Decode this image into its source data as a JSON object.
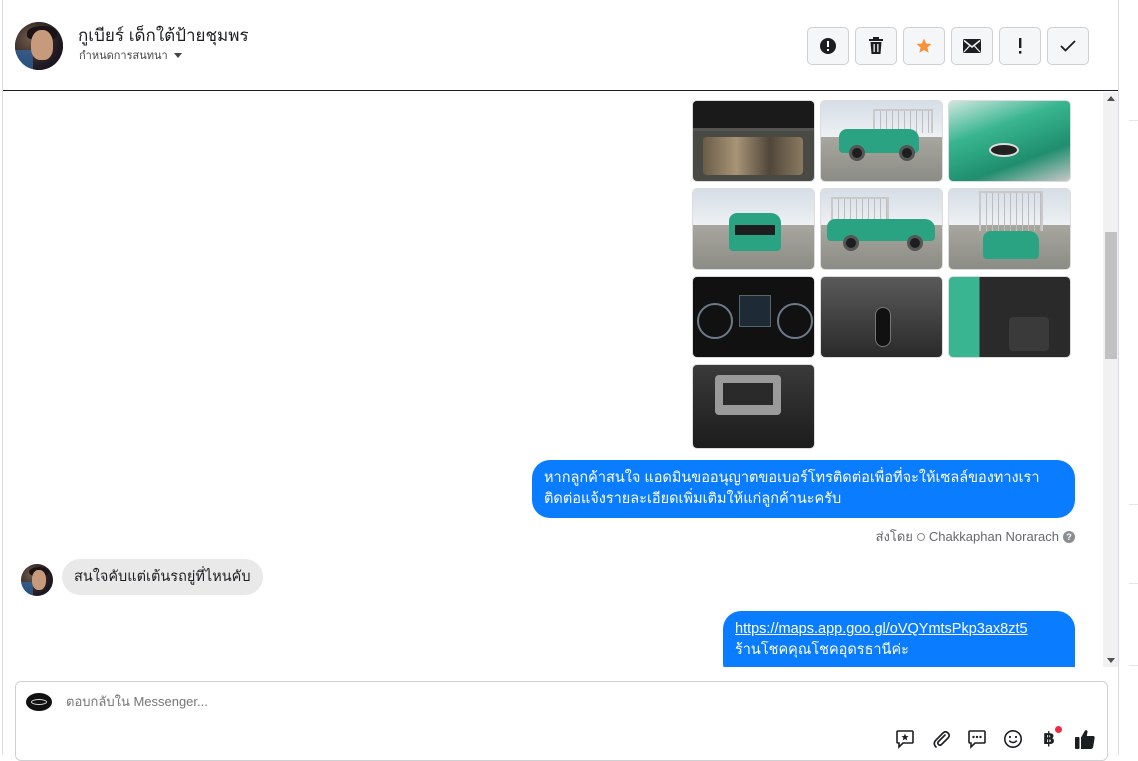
{
  "header": {
    "contact_name": "กูเบียร์ เด็กใต้ป้ายชุมพร",
    "assign_label": "กำหนดการสนทนา",
    "toolbar": [
      {
        "name": "spam-button",
        "icon": "alert-circle-icon"
      },
      {
        "name": "delete-button",
        "icon": "trash-icon"
      },
      {
        "name": "star-button",
        "icon": "star-icon"
      },
      {
        "name": "mark-unread-button",
        "icon": "envelope-icon"
      },
      {
        "name": "follow-up-button",
        "icon": "exclamation-icon"
      },
      {
        "name": "mark-done-button",
        "icon": "checkmark-icon"
      }
    ]
  },
  "messages": {
    "photo_count": 10,
    "outgoing_1": {
      "line1": "หากลูกค้าสนใจ แอดมินขออนุญาตขอเบอร์โทรติดต่อเพื่อที่จะให้เซลล์ของทางเรา",
      "line2": "ติดต่อแจ้งรายละเอียดเพิ่มเติมให้แก่ลูกค้านะครับ"
    },
    "sent_by_label": "ส่งโดย",
    "sent_by_name": "Chakkaphan Norarach",
    "incoming_1": "สนใจคับแต่เต้นรถยู่ที่ไหนคับ",
    "outgoing_2": {
      "link": "https://maps.app.goo.gl/oVQYmtsPkp3ax8zt5",
      "line2": "ร้านโชคคุณโชคอุดรธานีค่ะ"
    }
  },
  "composer": {
    "placeholder": "ตอบกลับใน Messenger..."
  },
  "colors": {
    "accent": "#0a7cff",
    "star": "#f7923a",
    "incoming_bubble": "#e9e9ea"
  }
}
